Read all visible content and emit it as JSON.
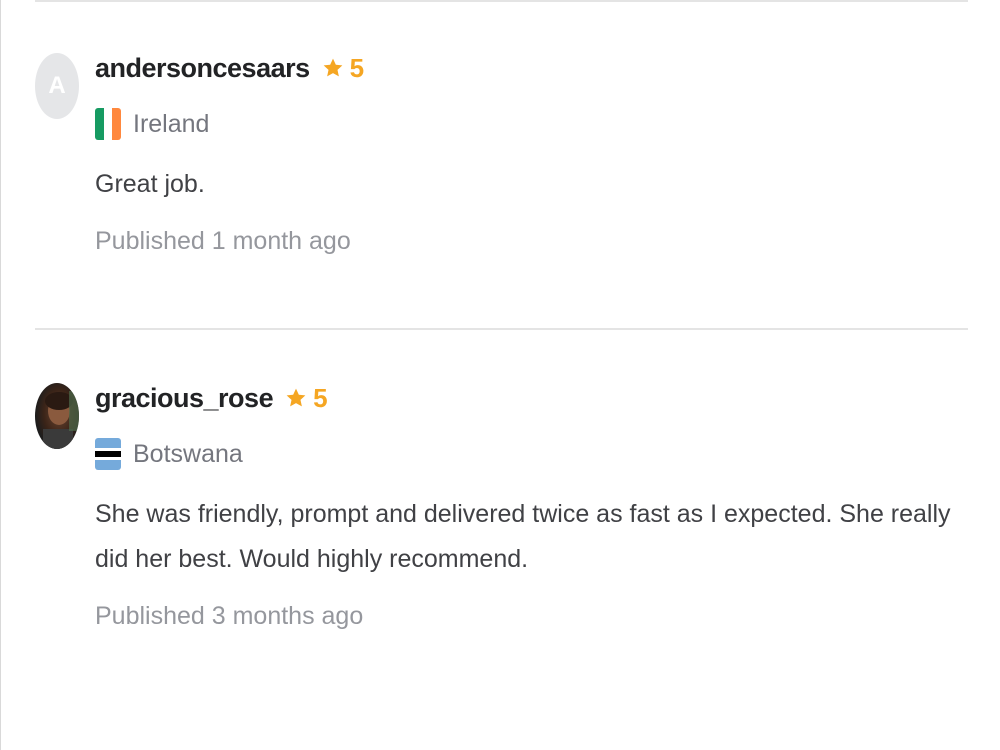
{
  "reviews": [
    {
      "avatar_letter": "A",
      "username": "andersoncesaars",
      "rating": "5",
      "country": "Ireland",
      "text": "Great job.",
      "published": "Published 1 month ago"
    },
    {
      "username": "gracious_rose",
      "rating": "5",
      "country": "Botswana",
      "text": "She was friendly, prompt and delivered twice as fast as I expected. She really did her best. Would highly recommend.",
      "published": "Published 3 months ago"
    }
  ],
  "colors": {
    "star": "#f5a623",
    "username": "#222325",
    "muted": "#74767e",
    "body": "#404145"
  },
  "icons": {
    "star": "star-icon",
    "flag_1": "ireland-flag-icon",
    "flag_2": "botswana-flag-icon"
  }
}
